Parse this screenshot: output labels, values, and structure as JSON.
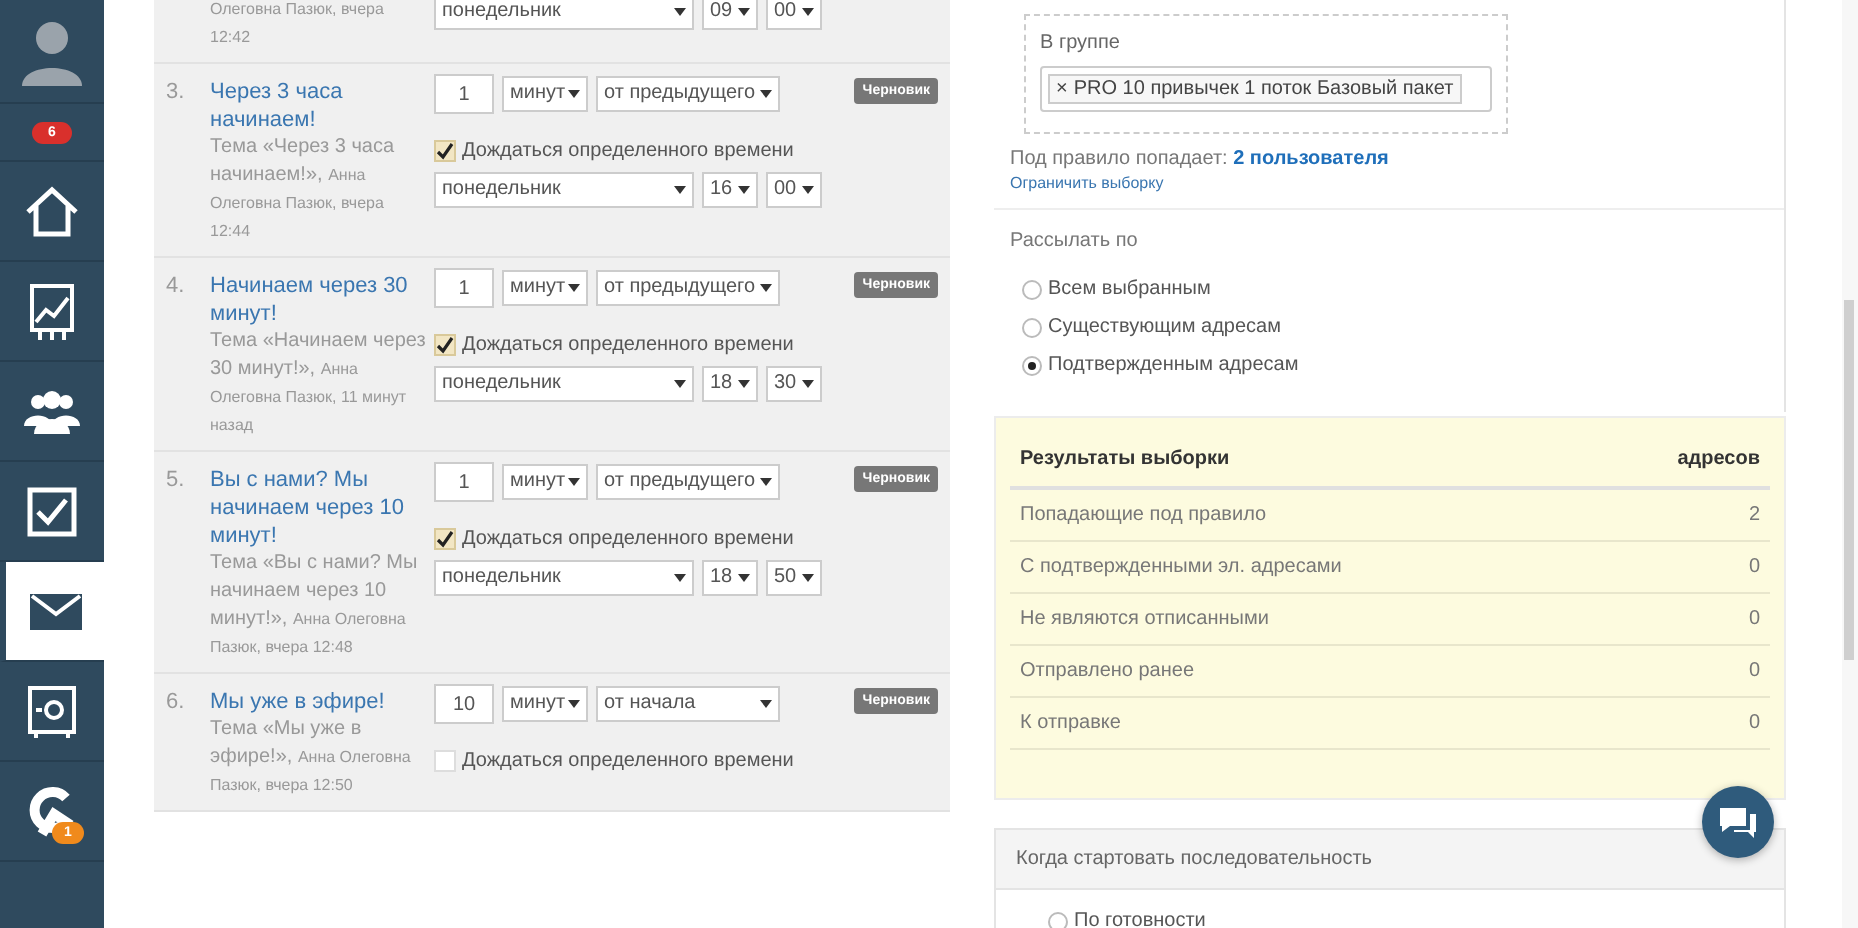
{
  "sidebar": {
    "items": [
      {
        "kind": "avatar",
        "selected": false
      },
      {
        "kind": "badge",
        "badge": "6"
      },
      {
        "kind": "home",
        "selected": false
      },
      {
        "kind": "chart",
        "selected": false
      },
      {
        "kind": "people",
        "selected": false
      },
      {
        "kind": "check",
        "selected": false
      },
      {
        "kind": "mail",
        "selected": true
      },
      {
        "kind": "safe",
        "selected": false
      },
      {
        "kind": "logo",
        "badge": "1",
        "selected": false
      }
    ]
  },
  "messages": [
    {
      "kind": "partial",
      "meta": "Олеговна Пазюк, вчера 12:42",
      "schedule": {
        "day": "понедельник",
        "hour": "09",
        "minute": "00"
      }
    },
    {
      "kind": "full",
      "number": "3.",
      "title": "Через 3 часа начинаем!",
      "subject": "Тема «Через 3 часа начинаем!»,",
      "meta": "Анна Олеговна Пазюк, вчера 12:44",
      "delay": "1",
      "unit": "минут",
      "from": "от предыдущего",
      "status": "Черновик",
      "wait": {
        "label": "Дождаться определенного времени",
        "checked": true
      },
      "schedule": {
        "day": "понедельник",
        "hour": "16",
        "minute": "00"
      }
    },
    {
      "kind": "full",
      "number": "4.",
      "title": "Начинаем через 30 минут!",
      "subject": "Тема «Начинаем через 30 минут!»,",
      "meta": "Анна Олеговна Пазюк, 11 минут назад",
      "delay": "1",
      "unit": "минут",
      "from": "от предыдущего",
      "status": "Черновик",
      "wait": {
        "label": "Дождаться определенного времени",
        "checked": true
      },
      "schedule": {
        "day": "понедельник",
        "hour": "18",
        "minute": "30"
      }
    },
    {
      "kind": "full",
      "number": "5.",
      "title": "Вы с нами? Мы начинаем через 10 минут!",
      "subject": "Тема «Вы с нами? Мы начинаем через 10 минут!»,",
      "meta": "Анна Олеговна Пазюк, вчера 12:48",
      "delay": "1",
      "unit": "минут",
      "from": "от предыдущего",
      "status": "Черновик",
      "wait": {
        "label": "Дождаться определенного времени",
        "checked": true
      },
      "schedule": {
        "day": "понедельник",
        "hour": "18",
        "minute": "50"
      }
    },
    {
      "kind": "full",
      "number": "6.",
      "title": "Мы уже в эфире!",
      "subject": "Тема «Мы уже в эфире!»,",
      "meta": "Анна Олеговна Пазюк, вчера 12:50",
      "delay": "10",
      "unit": "минут",
      "from": "от начала",
      "status": "Черновик",
      "wait": {
        "label": "Дождаться определенного времени",
        "checked": false
      }
    }
  ],
  "rule": {
    "group_label": "В группе",
    "remove_glyph": "×",
    "tags": [
      "PRO 10 привычек 1 поток Базовый пакет"
    ],
    "count_label": "Под правило попадает:",
    "count_link": "2 пользователя",
    "limit_link": "Ограничить выборку"
  },
  "send": {
    "label": "Рассылать по",
    "options": [
      {
        "label": "Всем выбранным",
        "selected": false
      },
      {
        "label": "Существующим адресам",
        "selected": false
      },
      {
        "label": "Подтвержденным адресам",
        "selected": true
      }
    ]
  },
  "results": {
    "columns": [
      "Результаты выборки",
      "адресов"
    ],
    "rows": [
      [
        "Попадающие под правило",
        "2"
      ],
      [
        "С подтвержденными эл. адресами",
        "0"
      ],
      [
        "Не являются отписанными",
        "0"
      ],
      [
        "Отправлено ранее",
        "0"
      ],
      [
        "К отправке",
        "0"
      ]
    ]
  },
  "start": {
    "title": "Когда стартовать последовательность",
    "options": [
      {
        "label": "По готовности",
        "selected": false
      }
    ]
  }
}
